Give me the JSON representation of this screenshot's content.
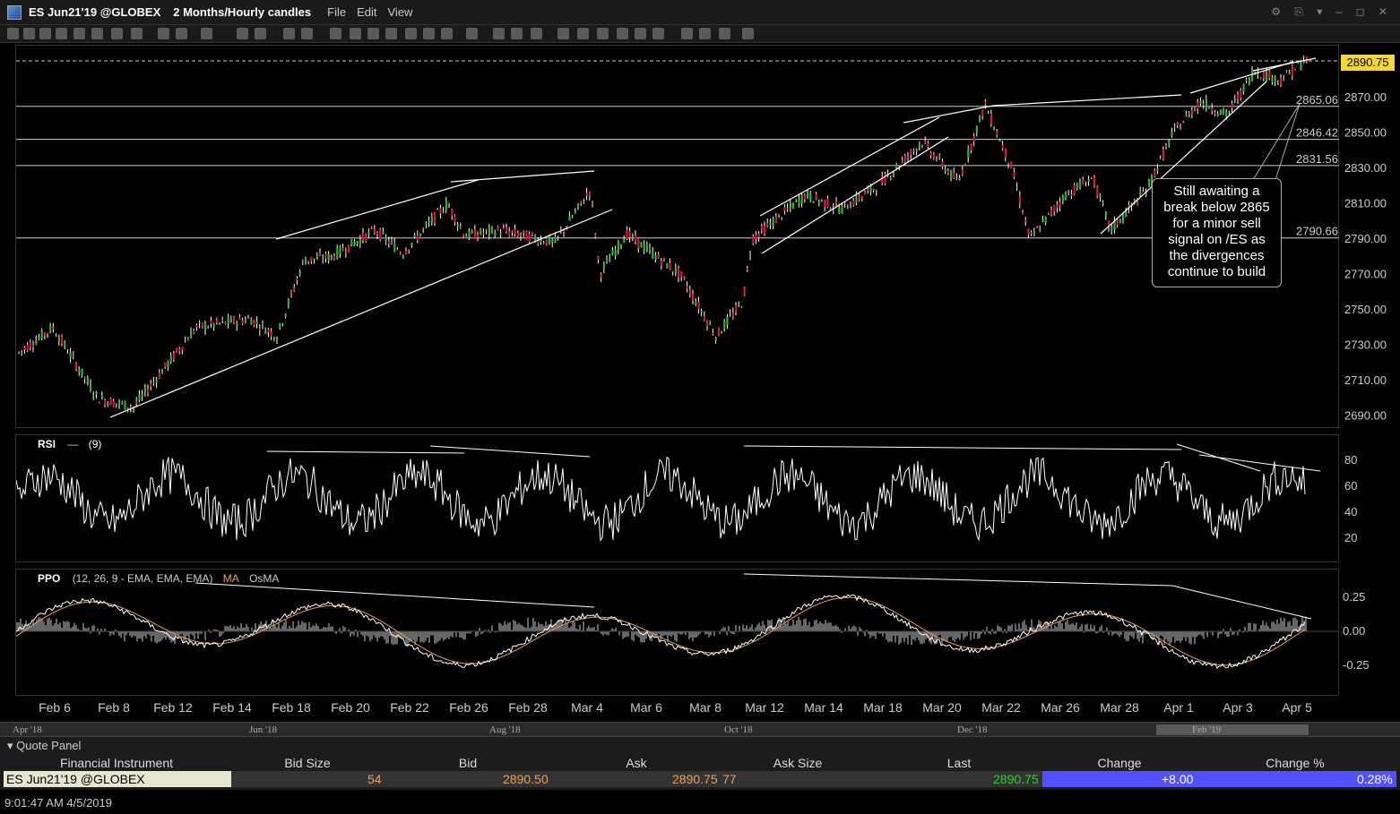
{
  "window": {
    "symbol": "ES Jun21'19 @GLOBEX",
    "period": "2 Months/Hourly candles",
    "menus": [
      "File",
      "Edit",
      "View"
    ]
  },
  "price_panel": {
    "last_price_tag": "2890.75",
    "y_ticks": [
      "2870.00",
      "2850.00",
      "2830.00",
      "2810.00",
      "2790.00",
      "2770.00",
      "2750.00",
      "2730.00",
      "2710.00",
      "2690.00"
    ],
    "levels": [
      "2865.06",
      "2846.42",
      "2831.56",
      "2790.66"
    ],
    "annotation": "Still awaiting a\nbreak below 2865\nfor a minor sell\nsignal on /ES as\nthe divergences\ncontinue to build"
  },
  "rsi_panel": {
    "title": "RSI",
    "period": "(9)",
    "y_ticks": [
      "80",
      "60",
      "40",
      "20"
    ]
  },
  "ppo_panel": {
    "title": "PPO",
    "params": "(12, 26, 9 - EMA, EMA, EMA)",
    "legend": [
      "MA",
      "OsMA"
    ],
    "y_ticks": [
      "0.25",
      "0.00",
      "-0.25"
    ]
  },
  "time_axis": [
    "Feb 6",
    "Feb 8",
    "Feb 12",
    "Feb 14",
    "Feb 18",
    "Feb 20",
    "Feb 22",
    "Feb 26",
    "Feb 28",
    "Mar 4",
    "Mar 6",
    "Mar 8",
    "Mar 12",
    "Mar 14",
    "Mar 18",
    "Mar 20",
    "Mar 22",
    "Mar 26",
    "Mar 28",
    "Apr 1",
    "Apr 3",
    "Apr 5"
  ],
  "scroller_labels": [
    "Apr '18",
    "Jun '18",
    "Aug '18",
    "Oct '18",
    "Dec '18",
    "Feb '19"
  ],
  "quote_panel": {
    "title": "Quote Panel",
    "headers": [
      "Financial Instrument",
      "Bid Size",
      "Bid",
      "Ask",
      "Ask Size",
      "Last",
      "Change",
      "Change %"
    ],
    "row": {
      "instrument": "ES Jun21'19 @GLOBEX",
      "bid_size": "54",
      "bid": "2890.50",
      "ask": "2890.75",
      "ask_size": "77",
      "last": "2890.75",
      "change": "+8.00",
      "change_pct": "0.28%"
    }
  },
  "status": {
    "timestamp": "9:01:47 AM 4/5/2019"
  },
  "colors": {
    "up": "#2fb32f",
    "down": "#d8163c",
    "price_tag": "#f2d632",
    "change_bg": "#5151ff",
    "ma_line": "#e8a060"
  }
}
